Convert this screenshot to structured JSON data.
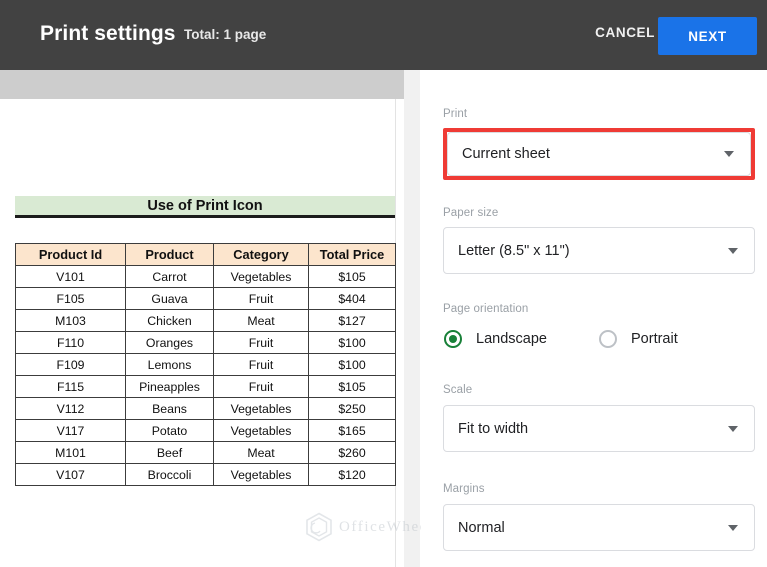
{
  "header": {
    "title": "Print settings",
    "subtitle": "Total: 1 page",
    "cancel_label": "CANCEL",
    "next_label": "NEXT",
    "bar_color": "#424242",
    "next_color": "#1a73e8"
  },
  "preview": {
    "sheet_title": "Use of Print Icon",
    "title_band_color": "#d9ead3",
    "header_row_color": "#fce5cd",
    "columns": [
      "Product Id",
      "Product",
      "Category",
      "Total Price"
    ],
    "rows": [
      [
        "V101",
        "Carrot",
        "Vegetables",
        "$105"
      ],
      [
        "F105",
        "Guava",
        "Fruit",
        "$404"
      ],
      [
        "M103",
        "Chicken",
        "Meat",
        "$127"
      ],
      [
        "F110",
        "Oranges",
        "Fruit",
        "$100"
      ],
      [
        "F109",
        "Lemons",
        "Fruit",
        "$100"
      ],
      [
        "F115",
        "Pineapples",
        "Fruit",
        "$105"
      ],
      [
        "V112",
        "Beans",
        "Vegetables",
        "$250"
      ],
      [
        "V117",
        "Potato",
        "Vegetables",
        "$165"
      ],
      [
        "M101",
        "Beef",
        "Meat",
        "$260"
      ],
      [
        "V107",
        "Broccoli",
        "Vegetables",
        "$120"
      ]
    ]
  },
  "watermark": {
    "text": "OfficeWheel"
  },
  "settings": {
    "print": {
      "label": "Print",
      "value": "Current sheet",
      "highlight_color": "#ef3b35"
    },
    "paper_size": {
      "label": "Paper size",
      "value": "Letter (8.5\" x 11\")"
    },
    "page_orientation": {
      "label": "Page orientation",
      "landscape_label": "Landscape",
      "portrait_label": "Portrait",
      "selected": "Landscape",
      "selected_color": "#188038"
    },
    "scale": {
      "label": "Scale",
      "value": "Fit to width"
    },
    "margins": {
      "label": "Margins",
      "value": "Normal"
    }
  }
}
